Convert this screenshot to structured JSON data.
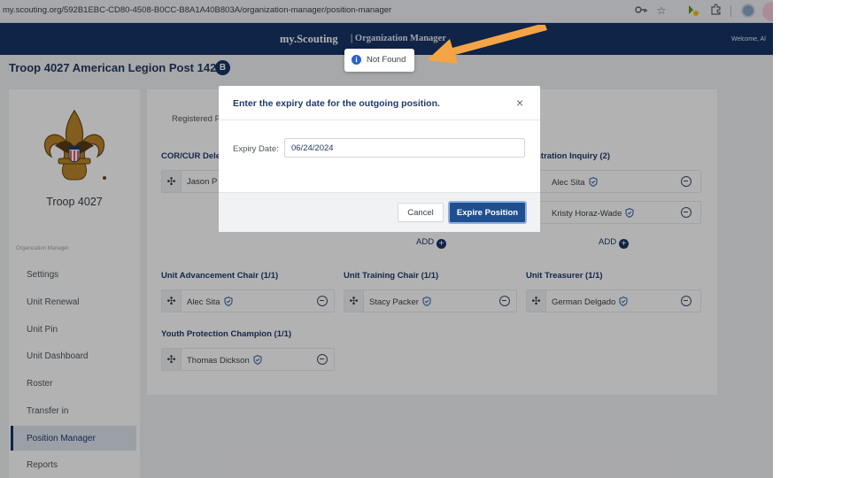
{
  "browser": {
    "url": "my.scouting.org/592B1EBC-CD80-4508-B0CC-B8A1A40B803A/organization-manager/position-manager"
  },
  "header": {
    "brand": "my.Scouting",
    "section": "| Organization Manager",
    "welcome": "Welcome, Al"
  },
  "page": {
    "title": "Troop 4027 American Legion Post 1420",
    "badge": "B"
  },
  "sidebar": {
    "troop_name": "Troop 4027",
    "section_label": "Organization Manager",
    "items": [
      {
        "label": "Settings"
      },
      {
        "label": "Unit Renewal"
      },
      {
        "label": "Unit Pin"
      },
      {
        "label": "Unit Dashboard"
      },
      {
        "label": "Roster"
      },
      {
        "label": "Transfer in"
      },
      {
        "label": "Position Manager",
        "active": true
      },
      {
        "label": "Reports"
      }
    ]
  },
  "main": {
    "tab_partial": "Registered P",
    "sections": {
      "cor": {
        "title": "COR/CUR Dele",
        "member": "Jason P"
      },
      "reg_inquiry": {
        "title": "istration Inquiry (2)",
        "members": [
          "Alec Sita",
          "Kristy Horaz-Wade"
        ]
      },
      "advancement": {
        "title": "Unit Advancement Chair (1/1)",
        "member": "Alec Sita"
      },
      "training": {
        "title": "Unit Training Chair (1/1)",
        "member": "Stacy Packer"
      },
      "treasurer": {
        "title": "Unit Treasurer (1/1)",
        "member": "German Delgado"
      },
      "youth": {
        "title": "Youth Protection Champion (1/1)",
        "member": "Thomas Dickson"
      }
    },
    "add_label": "ADD"
  },
  "modal": {
    "title": "Enter the expiry date for the outgoing position.",
    "close": "×",
    "label": "Expiry Date:",
    "value": "06/24/2024",
    "cancel": "Cancel",
    "confirm": "Expire Position"
  },
  "toast": {
    "icon": "info-icon",
    "message": "Not Found"
  },
  "colors": {
    "navy": "#163466",
    "accent_blue": "#1f4f8f",
    "arrow": "#f5a445"
  }
}
